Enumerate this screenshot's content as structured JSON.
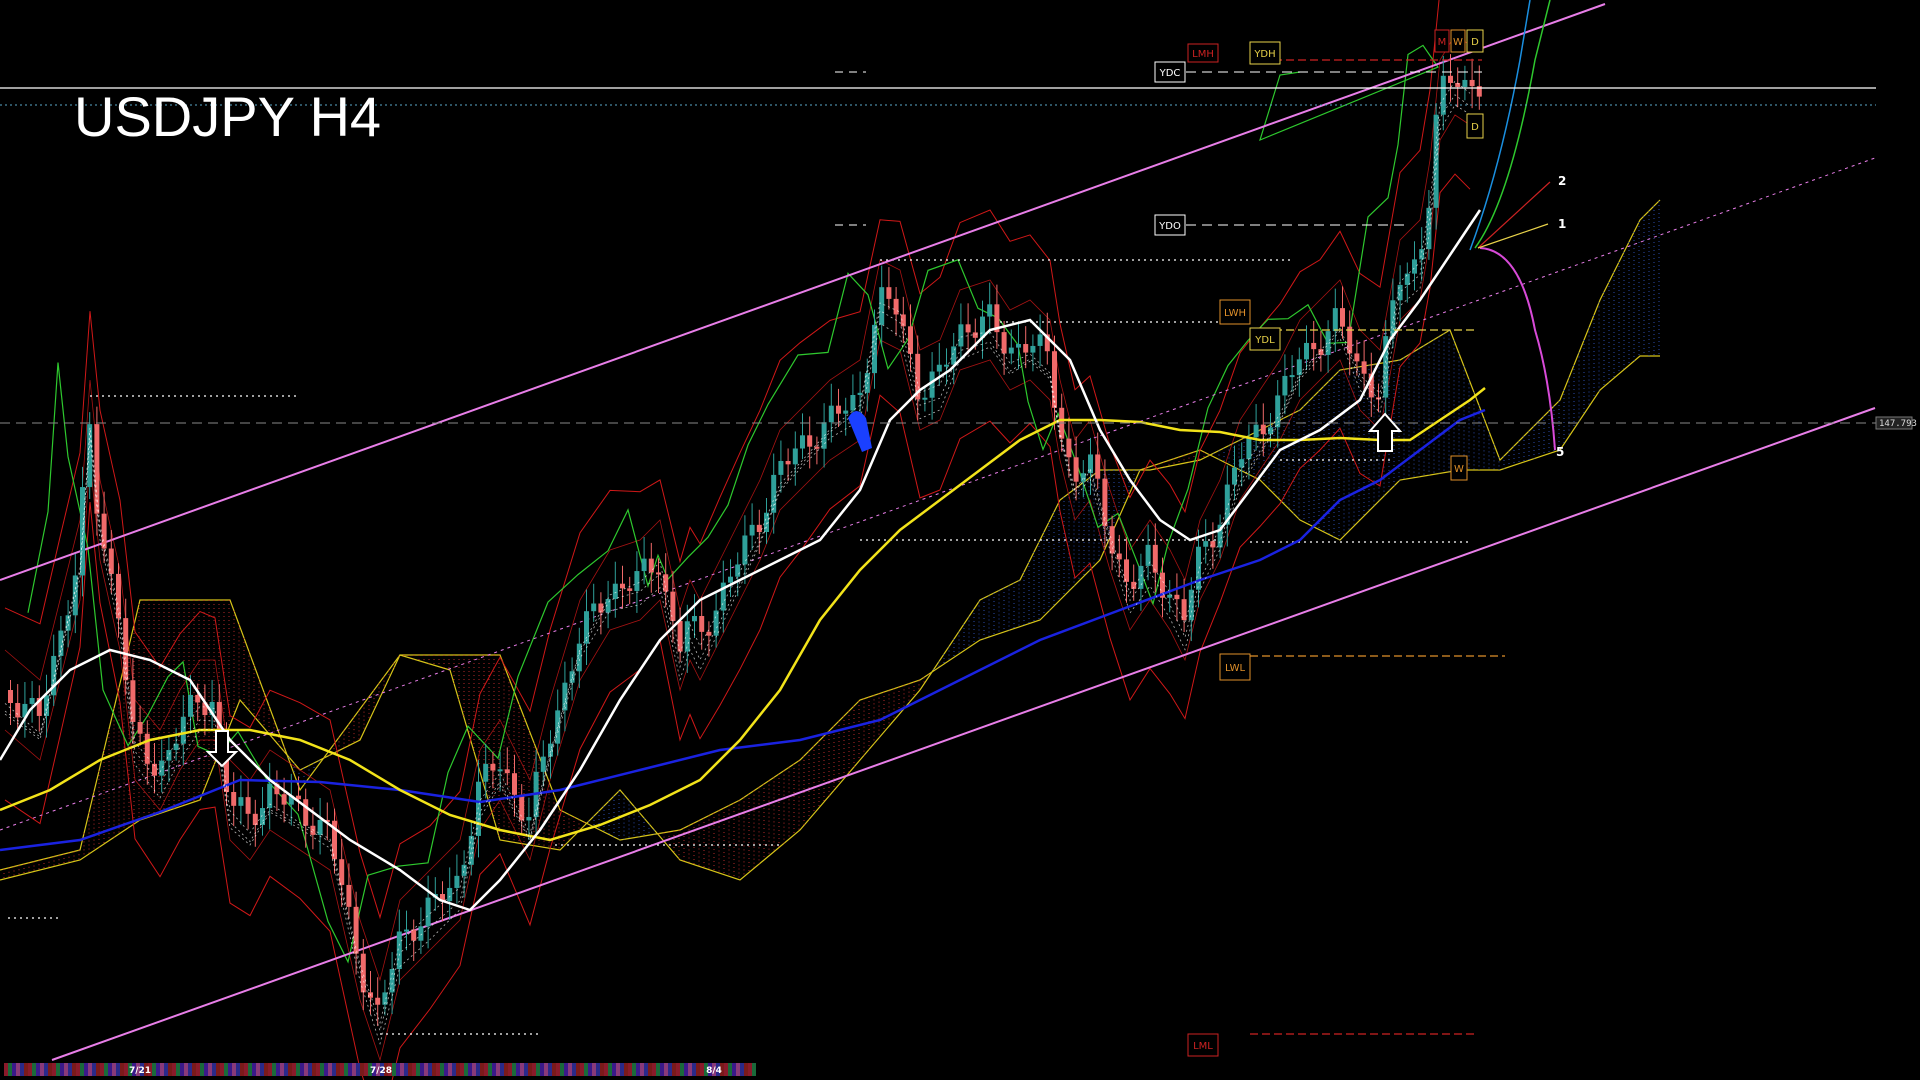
{
  "chart_data": {
    "type": "candlestick",
    "title": "USDJPY H4",
    "symbol": "USDJPY",
    "timeframe": "H4",
    "current_price": "147.793",
    "x_labels": [
      "7/21",
      "7/28",
      "8/4"
    ],
    "level_tags": [
      {
        "id": "lmh",
        "label": "LMH",
        "color": "#cc2222"
      },
      {
        "id": "ydh",
        "label": "YDH",
        "color": "#e8d24a"
      },
      {
        "id": "ydc",
        "label": "YDC",
        "color": "#ffffff"
      },
      {
        "id": "ydo",
        "label": "YDO",
        "color": "#ffffff"
      },
      {
        "id": "lwh",
        "label": "LWH",
        "color": "#e0902a"
      },
      {
        "id": "ydl",
        "label": "YDL",
        "color": "#e8d24a"
      },
      {
        "id": "lwl",
        "label": "LWL",
        "color": "#e0902a"
      },
      {
        "id": "lml",
        "label": "LML",
        "color": "#cc2222"
      },
      {
        "id": "m",
        "label": "M",
        "color": "#cc2222"
      },
      {
        "id": "w",
        "label": "W",
        "color": "#e0902a"
      },
      {
        "id": "d",
        "label": "D",
        "color": "#e8d24a"
      },
      {
        "id": "d2",
        "label": "D",
        "color": "#e8d24a"
      },
      {
        "id": "w2",
        "label": "W",
        "color": "#e0902a"
      }
    ],
    "projection_labels": [
      "2",
      "1",
      "5"
    ],
    "signals": [
      {
        "type": "sell-arrow",
        "near": "7/24"
      },
      {
        "type": "buy-arrow",
        "near": "8/5"
      }
    ],
    "colors": {
      "background": "#000000",
      "bull_candle": "#2fa09a",
      "bear_candle": "#f06a6a",
      "channel": "#e87ee8",
      "ma_fast": "#ffffff",
      "ma_mid": "#f2e31a",
      "ma_slow": "#1a22e0",
      "bollinger": "#d01818",
      "chikou": "#2ec82e",
      "kumo_bull": "#2a4aa8",
      "kumo_bear": "#b02a2a",
      "kumo_edge": "#d7c418"
    },
    "grid": false
  }
}
